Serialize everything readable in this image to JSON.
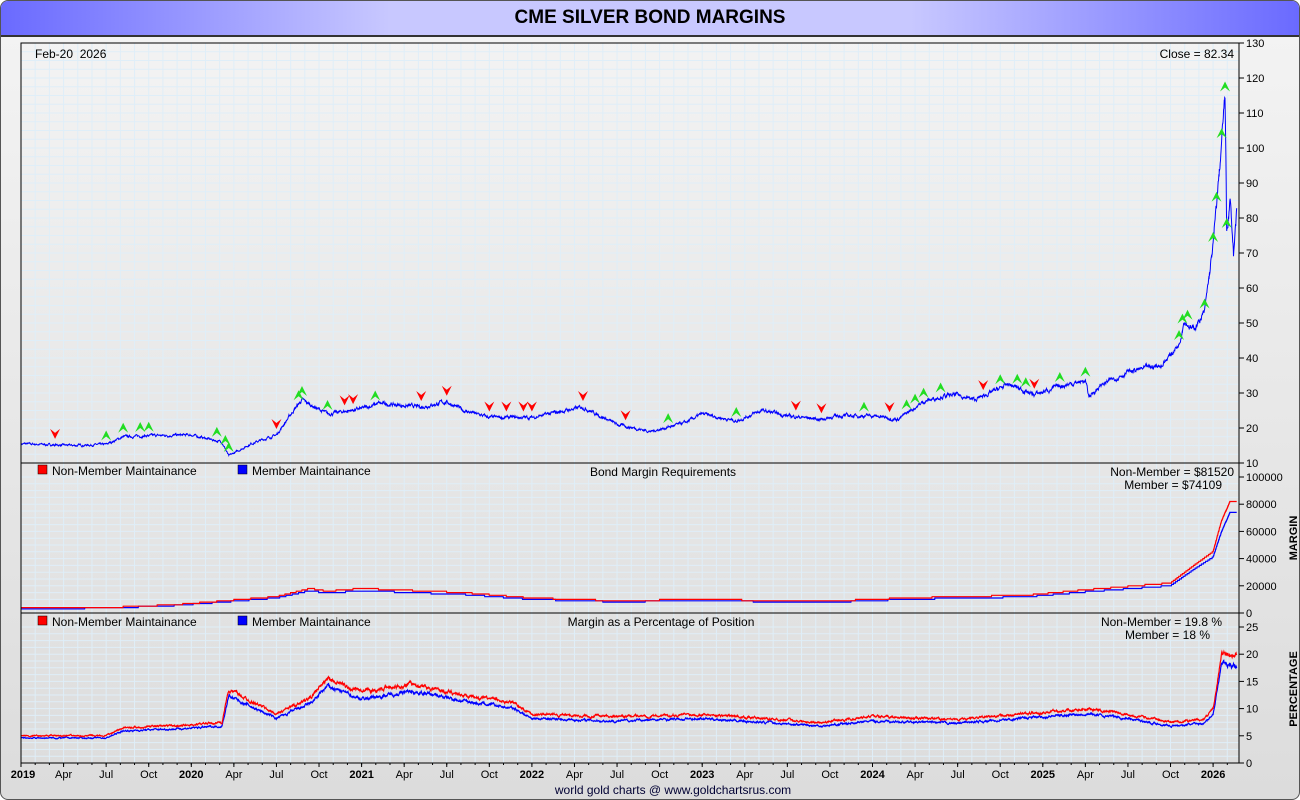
{
  "title": "CME SILVER BOND MARGINS",
  "footer": "world gold charts @ www.goldchartsrus.com",
  "colors": {
    "price": "#0000ff",
    "non_member": "#ff0000",
    "member": "#0000ff",
    "up_arrow": "#22dd22",
    "down_arrow": "#ff0000",
    "grid": "#dfeef8"
  },
  "chart_data": [
    {
      "type": "line",
      "title": "",
      "date_label": "Feb-20  2026",
      "close_label": "Close = 82.34",
      "ylim": [
        10,
        130
      ],
      "yticks": [
        10,
        20,
        30,
        40,
        50,
        60,
        70,
        80,
        90,
        100,
        110,
        120,
        130
      ],
      "x": [
        2019.0,
        2019.3,
        2019.5,
        2019.6,
        2019.75,
        2020.0,
        2020.18,
        2020.22,
        2020.35,
        2020.5,
        2020.6,
        2020.65,
        2020.8,
        2021.0,
        2021.1,
        2021.35,
        2021.5,
        2021.6,
        2021.75,
        2022.0,
        2022.3,
        2022.5,
        2022.7,
        2022.9,
        2023.0,
        2023.2,
        2023.35,
        2023.5,
        2023.7,
        2023.8,
        2024.0,
        2024.15,
        2024.3,
        2024.4,
        2024.5,
        2024.6,
        2024.8,
        2024.95,
        2025.1,
        2025.25,
        2025.27,
        2025.35,
        2025.5,
        2025.7,
        2025.8,
        2025.83,
        2025.88,
        2025.95,
        2026.0,
        2026.04,
        2026.07,
        2026.08,
        2026.1,
        2026.12,
        2026.14
      ],
      "series": [
        {
          "name": "Silver price",
          "values": [
            15.5,
            15,
            15.3,
            17.5,
            17.8,
            18,
            16,
            12,
            15.5,
            18,
            25,
            28,
            24,
            25.5,
            27,
            26,
            27.5,
            25,
            23,
            23,
            26,
            21,
            19,
            21.5,
            24,
            22,
            25,
            23.5,
            22.5,
            23.5,
            23.5,
            22.5,
            27.5,
            29,
            29.5,
            28,
            32.5,
            29.5,
            32,
            33.5,
            29,
            32.5,
            36,
            38,
            44,
            51,
            48,
            53,
            72,
            95,
            115,
            76,
            85,
            70,
            82.34
          ]
        }
      ],
      "up_arrows": [
        2019.5,
        2019.6,
        2019.7,
        2019.75,
        2020.15,
        2020.2,
        2020.22,
        2020.63,
        2020.65,
        2020.8,
        2021.08,
        2022.8,
        2023.2,
        2023.95,
        2024.2,
        2024.25,
        2024.3,
        2024.4,
        2024.75,
        2024.85,
        2024.9,
        2025.1,
        2025.25,
        2025.8,
        2025.82,
        2025.85,
        2025.95,
        2026.0,
        2026.02,
        2026.05,
        2026.07,
        2026.08
      ],
      "down_arrows": [
        2019.2,
        2020.5,
        2020.9,
        2020.95,
        2021.35,
        2021.5,
        2021.75,
        2021.85,
        2021.95,
        2022.0,
        2022.3,
        2022.55,
        2023.55,
        2023.7,
        2024.1,
        2024.65,
        2024.95
      ]
    },
    {
      "type": "line",
      "title": "Bond Margin Requirements",
      "ylabel": "MARGIN",
      "ylim": [
        0,
        100000
      ],
      "yticks": [
        0,
        20000,
        40000,
        60000,
        80000,
        100000
      ],
      "legend": [
        "Non-Member Maintainance",
        "Member Maintainance"
      ],
      "readout": [
        "Non-Member = $81520",
        "Member = $74109"
      ],
      "x": [
        2019.0,
        2019.5,
        2019.9,
        2020.2,
        2020.5,
        2020.7,
        2020.8,
        2021.0,
        2021.6,
        2022.0,
        2022.5,
        2023.0,
        2023.7,
        2024.2,
        2024.5,
        2024.9,
        2025.25,
        2025.75,
        2025.9,
        2026.0,
        2026.05,
        2026.1,
        2026.14
      ],
      "series": [
        {
          "name": "Non-Member Maintainance",
          "values": [
            3500,
            4000,
            6000,
            9000,
            12000,
            18000,
            16000,
            18000,
            15000,
            11000,
            9000,
            10000,
            8500,
            11000,
            12000,
            13000,
            17000,
            22000,
            36000,
            45000,
            68000,
            82000,
            81520
          ]
        },
        {
          "name": "Member Maintainance",
          "values": [
            3200,
            3600,
            5500,
            8200,
            11000,
            16400,
            14500,
            16400,
            13600,
            10000,
            8200,
            9100,
            7700,
            10000,
            10900,
            11800,
            15500,
            20000,
            33000,
            41000,
            60000,
            74000,
            74109
          ]
        }
      ]
    },
    {
      "type": "line",
      "title": "Margin as a Percentage of Position",
      "ylabel": "PERCENTAGE",
      "ylim": [
        0,
        25
      ],
      "yticks": [
        0,
        5,
        10,
        15,
        20,
        25
      ],
      "legend": [
        "Non-Member Maintainance",
        "Member Maintainance"
      ],
      "readout": [
        "Non-Member = 19.8 %",
        "Member = 18 %"
      ],
      "x": [
        2019.0,
        2019.5,
        2019.6,
        2020.0,
        2020.18,
        2020.22,
        2020.5,
        2020.7,
        2020.8,
        2021.0,
        2021.3,
        2021.6,
        2021.9,
        2022.0,
        2022.5,
        2023.0,
        2023.7,
        2024.0,
        2024.5,
        2025.25,
        2025.5,
        2025.75,
        2025.95,
        2026.0,
        2026.05,
        2026.14
      ],
      "series": [
        {
          "name": "Non-Member Maintainance",
          "values": [
            5,
            5,
            6.5,
            7,
            7.5,
            13.5,
            9,
            12,
            15.5,
            13,
            14.5,
            12.5,
            11,
            9,
            8.5,
            9,
            7.5,
            8.5,
            8,
            10,
            9,
            7.5,
            8,
            10,
            20,
            19.8
          ]
        },
        {
          "name": "Member Maintainance",
          "values": [
            4.6,
            4.6,
            5.9,
            6.4,
            6.8,
            12.3,
            8.2,
            10.9,
            14.1,
            11.8,
            13.2,
            11.4,
            10,
            8.2,
            7.7,
            8.2,
            6.8,
            7.7,
            7.3,
            9.1,
            8.2,
            6.8,
            7.3,
            9.1,
            18,
            18
          ]
        }
      ]
    }
  ],
  "x_axis": {
    "labels": [
      "2019",
      "Apr",
      "Jul",
      "Oct",
      "2020",
      "Apr",
      "Jul",
      "Oct",
      "2021",
      "Apr",
      "Jul",
      "Oct",
      "2022",
      "Apr",
      "Jul",
      "Oct",
      "2023",
      "Apr",
      "Jul",
      "Oct",
      "2024",
      "Apr",
      "Jul",
      "Oct",
      "2025",
      "Apr",
      "Jul",
      "Oct",
      "2026"
    ]
  }
}
